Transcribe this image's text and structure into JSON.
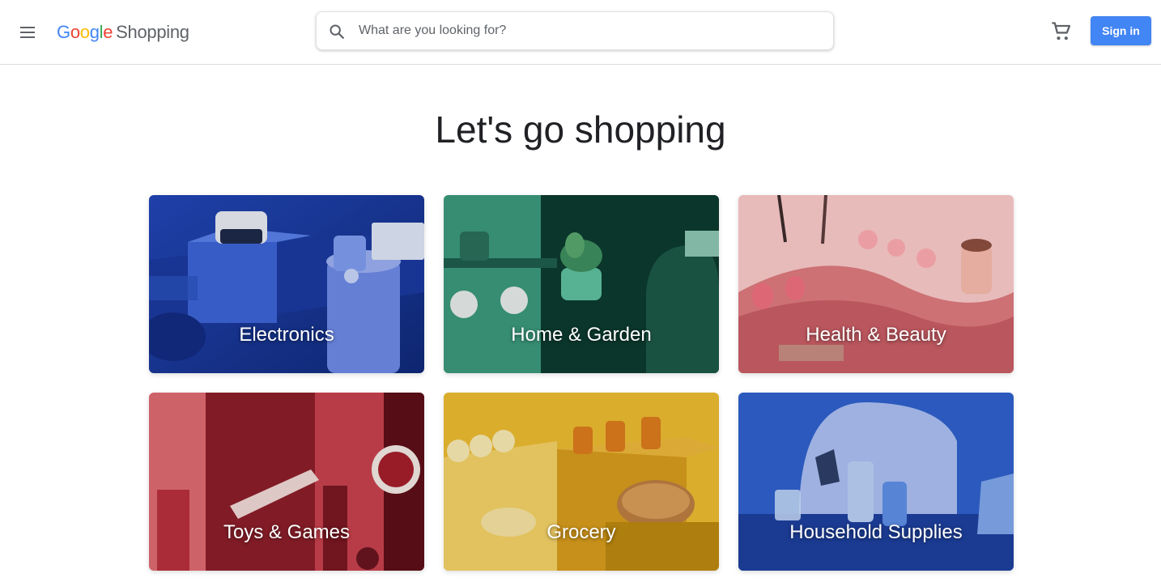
{
  "header": {
    "logo": {
      "google_letters": [
        "G",
        "o",
        "o",
        "g",
        "l",
        "e"
      ],
      "product": "Shopping"
    },
    "search": {
      "placeholder": "What are you looking for?",
      "value": ""
    },
    "sign_in_label": "Sign in",
    "icons": [
      "menu-icon",
      "search-icon",
      "cart-icon"
    ]
  },
  "main": {
    "headline": "Let's go shopping",
    "categories": [
      {
        "label": "Electronics",
        "color": "#1a3ea8"
      },
      {
        "label": "Home & Garden",
        "color": "#2b7a63"
      },
      {
        "label": "Health & Beauty",
        "color": "#e99a9c"
      },
      {
        "label": "Toys & Games",
        "color": "#b8303d"
      },
      {
        "label": "Grocery",
        "color": "#e2b12c"
      },
      {
        "label": "Household Supplies",
        "color": "#2e5fc9"
      }
    ]
  },
  "colors": {
    "accent": "#4285f4",
    "google_blue": "#4285f4",
    "google_red": "#ea4335",
    "google_yellow": "#fbbc05",
    "google_green": "#34a853"
  }
}
